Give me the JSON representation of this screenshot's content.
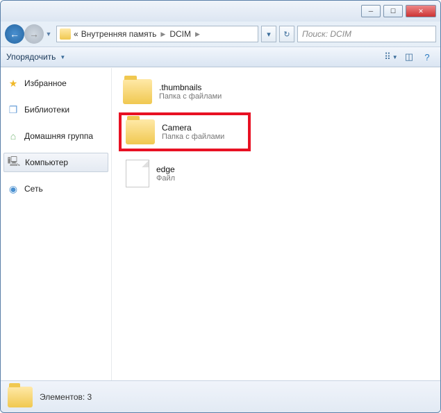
{
  "breadcrumb": {
    "pre": "«",
    "seg1": "Внутренняя память",
    "seg2": "DCIM"
  },
  "search": {
    "placeholder": "Поиск: DCIM"
  },
  "toolbar": {
    "organize": "Упорядочить"
  },
  "nav": {
    "favorites": "Избранное",
    "libraries": "Библиотеки",
    "homegroup": "Домашняя группа",
    "computer": "Компьютер",
    "network": "Сеть"
  },
  "items": [
    {
      "name": ".thumbnails",
      "sub": "Папка с файлами",
      "type": "folder",
      "highlight": false
    },
    {
      "name": "Camera",
      "sub": "Папка с файлами",
      "type": "folder",
      "highlight": true
    },
    {
      "name": "edge",
      "sub": "Файл",
      "type": "file",
      "highlight": false
    }
  ],
  "status": {
    "text": "Элементов: 3"
  }
}
